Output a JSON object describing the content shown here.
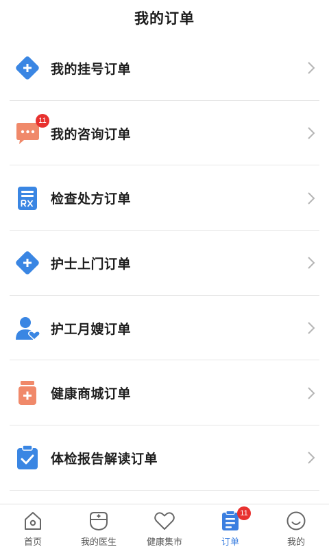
{
  "header": {
    "title": "我的订单"
  },
  "orders": [
    {
      "label": "我的挂号订单",
      "icon": "registration-plus-icon"
    },
    {
      "label": "我的咨询订单",
      "icon": "consultation-chat-icon",
      "badge": "11"
    },
    {
      "label": "检查处方订单",
      "icon": "prescription-rx-icon"
    },
    {
      "label": "护士上门订单",
      "icon": "nurse-plus-icon"
    },
    {
      "label": "护工月嫂订单",
      "icon": "caregiver-person-icon"
    },
    {
      "label": "健康商城订单",
      "icon": "medicine-bottle-icon"
    },
    {
      "label": "体检报告解读订单",
      "icon": "checkup-clipboard-icon"
    }
  ],
  "tabbar": {
    "tabs": [
      {
        "label": "首页",
        "icon": "home-icon"
      },
      {
        "label": "我的医生",
        "icon": "doctor-icon"
      },
      {
        "label": "健康集市",
        "icon": "heart-icon"
      },
      {
        "label": "订单",
        "icon": "orders-list-icon",
        "badge": "11",
        "active": true
      },
      {
        "label": "我的",
        "icon": "smile-profile-icon"
      }
    ]
  },
  "colors": {
    "blue": "#3a86e3",
    "orange": "#f0896a",
    "active_tab": "#3a7ee0",
    "badge": "#e8312f"
  }
}
